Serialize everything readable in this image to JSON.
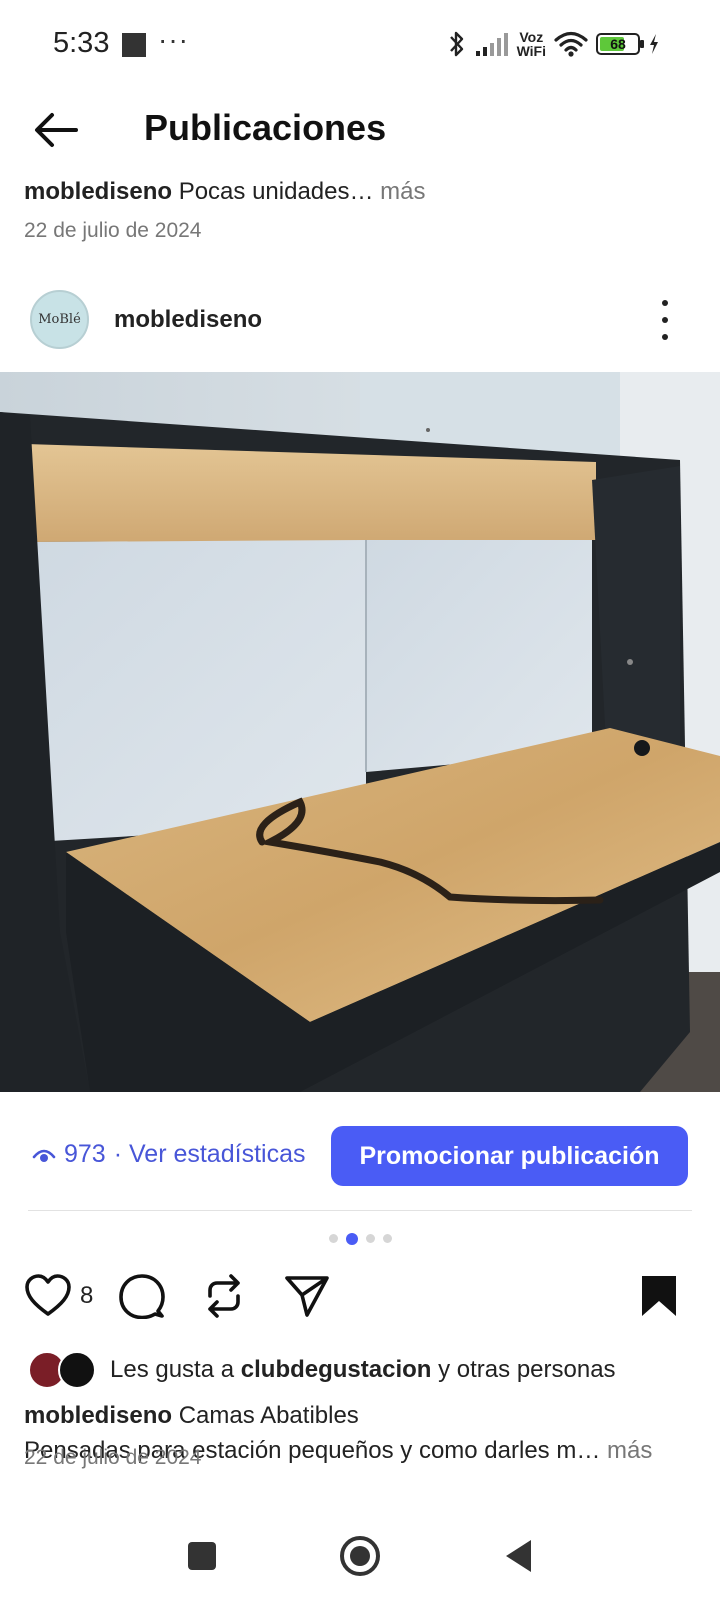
{
  "status_bar": {
    "time": "5:33",
    "dots": "···",
    "voz_line1": "Voz",
    "voz_line2": "WiFi",
    "battery": "68",
    "battery_level": 0.68
  },
  "header": {
    "title": "Publicaciones"
  },
  "previous_post": {
    "username": "moblediseno",
    "caption": "Pocas unidades…",
    "more": "más",
    "date": "22 de julio de 2024"
  },
  "post": {
    "avatar_text": "MoBlé",
    "username": "moblediseno",
    "views_count": "973",
    "views_label": "· Ver estadísticas",
    "promote_label": "Promocionar publicación",
    "carousel": {
      "count": 4,
      "active": 1
    },
    "likes_count": "8",
    "likes_prefix": "Les gusta a",
    "likes_user": "clubdegustacion",
    "likes_suffix": "y otras personas",
    "caption_username": "moblediseno",
    "caption_line1": "Camas  Abatibles",
    "caption_line2": "Pensadas para estación pequeños y como darles m…",
    "caption_more": "más",
    "date": "22 de julio de 2024"
  },
  "colors": {
    "accent": "#4a5cf5",
    "link": "#4856d8",
    "muted": "#777777"
  },
  "icons": {
    "back": "arrow-left-icon",
    "menu": "more-vertical-icon",
    "views": "eye-icon",
    "like": "heart-icon",
    "comment": "comment-icon",
    "repost": "repost-icon",
    "share": "send-icon",
    "save": "bookmark-icon"
  }
}
